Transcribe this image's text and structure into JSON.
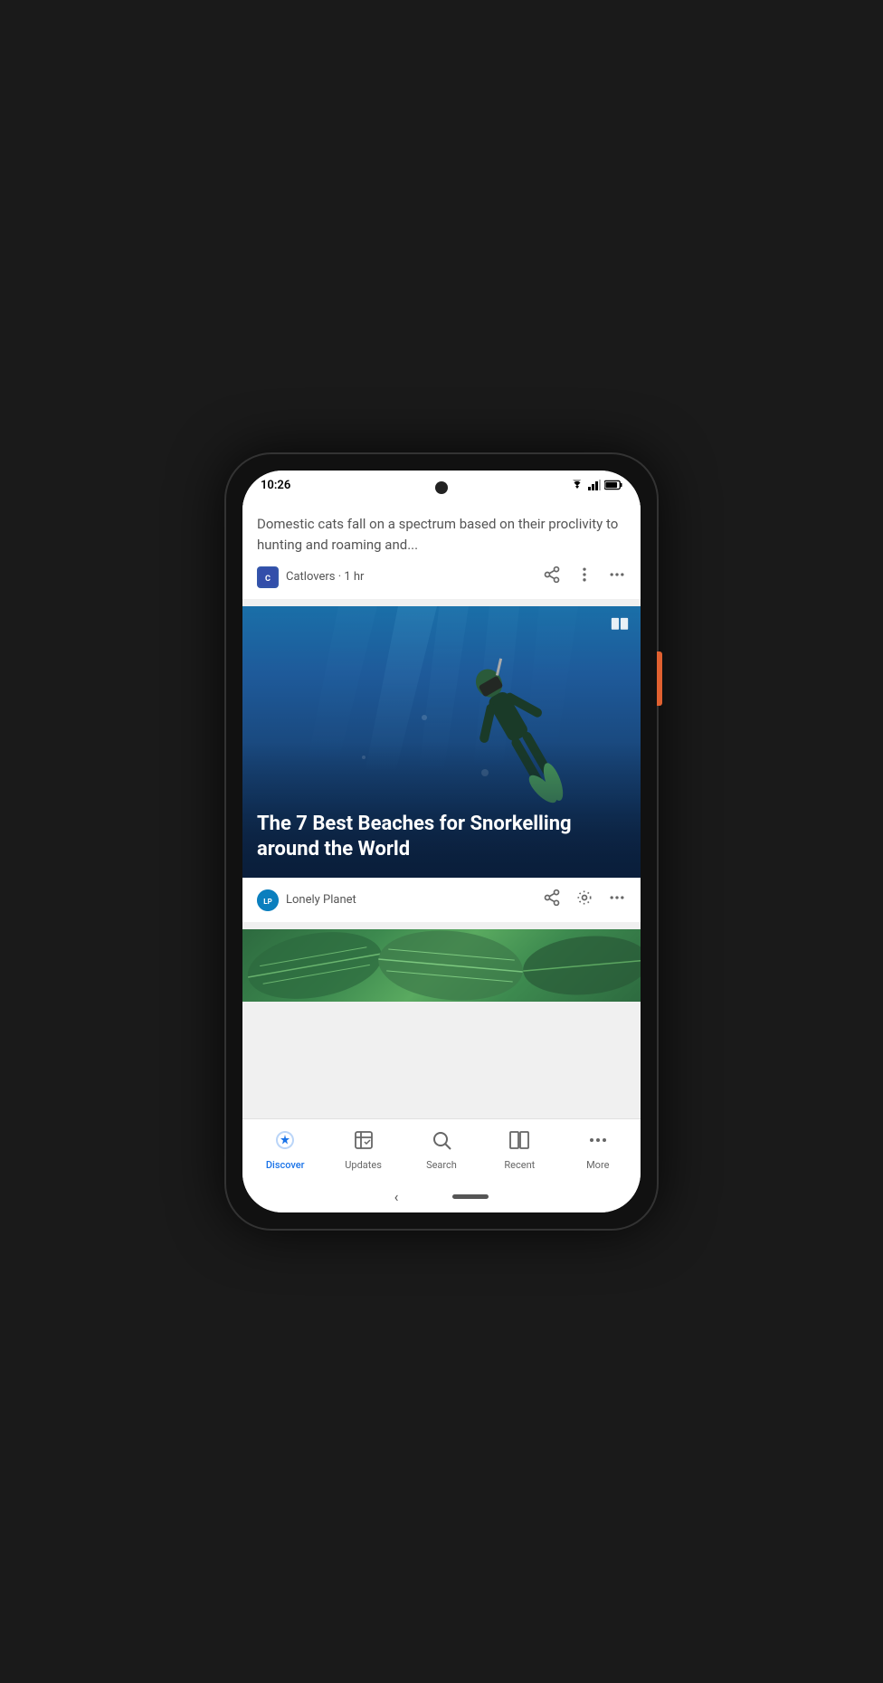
{
  "phone": {
    "status_bar": {
      "time": "10:26"
    },
    "cards": [
      {
        "id": "cat-card",
        "description": "Domestic cats fall on a spectrum based on their proclivity to hunting and roaming and...",
        "source": {
          "name": "Catlovers",
          "logo_letter": "C",
          "time_ago": "1 hr"
        }
      },
      {
        "id": "beach-card",
        "image_alt": "Snorkeler diving underwater",
        "title": "The 7 Best Beaches for Snorkelling around the World",
        "source": {
          "name": "Lonely Planet",
          "logo_letter": "LP"
        }
      }
    ],
    "bottom_nav": {
      "items": [
        {
          "id": "discover",
          "label": "Discover",
          "icon": "✳",
          "active": true
        },
        {
          "id": "updates",
          "label": "Updates",
          "icon": "⊡",
          "active": false
        },
        {
          "id": "search",
          "label": "Search",
          "icon": "⌕",
          "active": false
        },
        {
          "id": "recent",
          "label": "Recent",
          "icon": "▣",
          "active": false
        },
        {
          "id": "more",
          "label": "More",
          "icon": "…",
          "active": false
        }
      ]
    }
  }
}
